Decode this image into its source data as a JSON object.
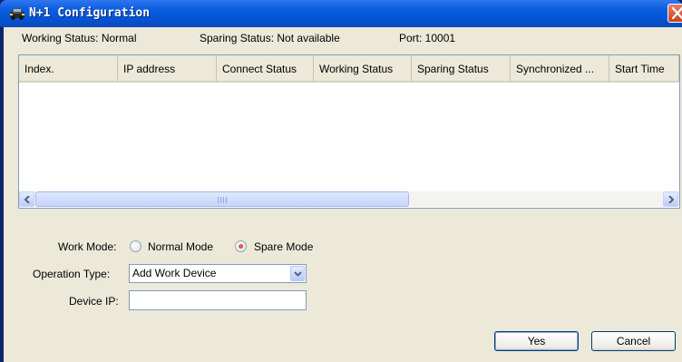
{
  "window": {
    "title": "N+1 Configuration",
    "title_icon": "car-icon",
    "close_icon": "close-icon"
  },
  "status": {
    "working_status": "Working Status: Normal",
    "sparing_status": "Sparing Status: Not available",
    "port": "Port: 10001"
  },
  "table": {
    "columns": [
      "Index.",
      "IP address",
      "Connect Status",
      "Working Status",
      "Sparing Status",
      "Synchronized ...",
      "Start Time"
    ],
    "rows": []
  },
  "form": {
    "work_mode_label": "Work Mode:",
    "normal_mode_label": "Normal Mode",
    "spare_mode_label": "Spare Mode",
    "work_mode_selected": "Spare Mode",
    "operation_type_label": "Operation Type:",
    "operation_type_value": "Add Work Device",
    "device_ip_label": "Device IP:",
    "device_ip_value": ""
  },
  "buttons": {
    "yes": "Yes",
    "cancel": "Cancel"
  },
  "colors": {
    "titlebar": "#0654d4",
    "dialog_bg": "#ece9d8",
    "close_button": "#c8421d"
  }
}
